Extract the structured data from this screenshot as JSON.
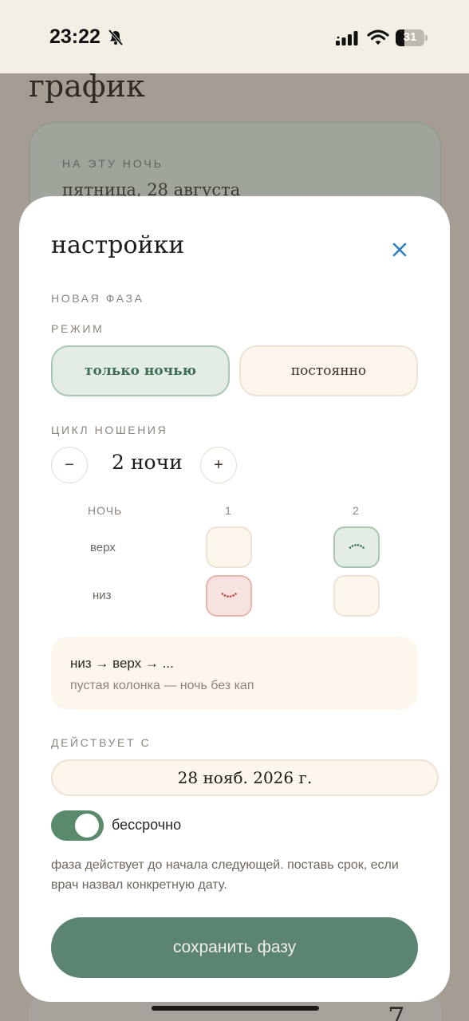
{
  "status_bar": {
    "time": "23:22",
    "battery_percent": 31,
    "battery_label": "31"
  },
  "background_page": {
    "title": "график",
    "card_caption": "НА ЭТУ НОЧЬ",
    "card_date": "пятница, 28 августа",
    "bottom_number": "7"
  },
  "sheet": {
    "title": "настройки",
    "section_new_phase": "НОВАЯ ФАЗА",
    "section_mode": "РЕЖИМ",
    "mode_options": [
      {
        "label": "только ночью",
        "selected": true
      },
      {
        "label": "постоянно",
        "selected": false
      }
    ],
    "section_cycle": "ЦИКЛ НОШЕНИЯ",
    "cycle": {
      "minus": "−",
      "value": "2 ночи",
      "plus": "+"
    },
    "grid": {
      "header": {
        "label": "НОЧЬ",
        "col1": "1",
        "col2": "2"
      },
      "rows": [
        {
          "label": "верх",
          "cells": [
            "empty",
            "top"
          ]
        },
        {
          "label": "низ",
          "cells": [
            "bottom",
            "empty"
          ]
        }
      ]
    },
    "info": {
      "sequence": "низ → верх → ...",
      "hint": "пустая колонка — ночь без кап"
    },
    "section_effective": "ДЕЙСТВУЕТ С",
    "effective_date": "28 нояб. 2026 г.",
    "indefinite": {
      "label": "бессрочно",
      "on": true
    },
    "note": "фаза действует до начала следующей. поставь срок, если врач назвал конкретную дату.",
    "save_label": "сохранить фазу"
  },
  "colors": {
    "accent_green": "#5b8570",
    "close_blue": "#2f7fc1",
    "top_cell_green": "#a9c6b2",
    "bottom_cell_red": "#e5b6ae"
  },
  "icons": {
    "close": "close-icon",
    "bell_muted": "bell-slash-icon",
    "signal": "signal-icon",
    "wifi": "wifi-icon",
    "battery": "battery-icon"
  }
}
